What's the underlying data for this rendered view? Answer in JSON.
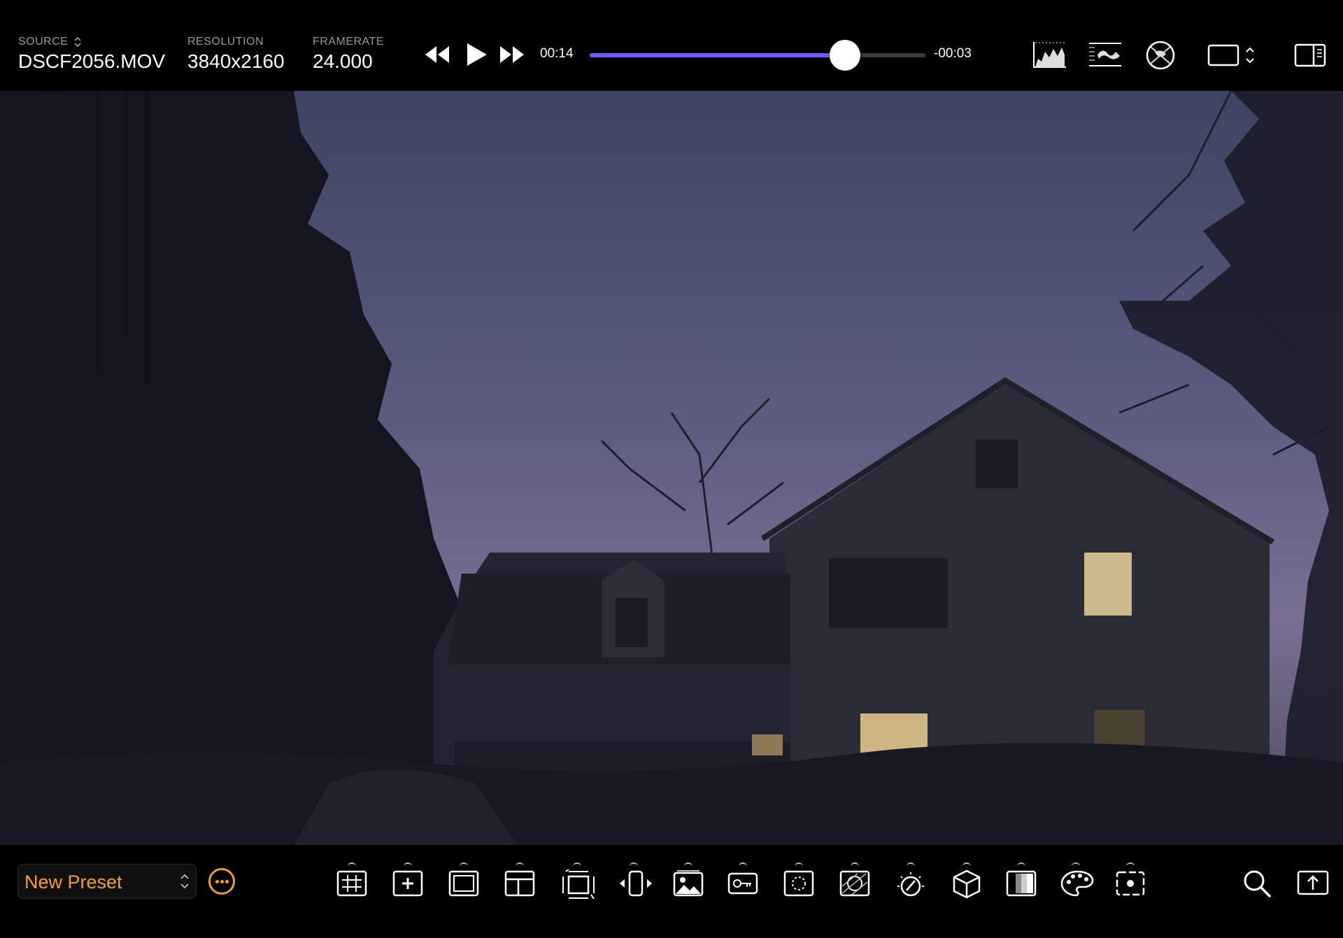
{
  "header": {
    "source": {
      "label": "SOURCE",
      "value": "DSCF2056.MOV"
    },
    "resolution": {
      "label": "RESOLUTION",
      "value": "3840x2160"
    },
    "framerate": {
      "label": "FRAMERATE",
      "value": "24.000"
    }
  },
  "transport": {
    "elapsed": "00:14",
    "remaining": "-00:03",
    "progress_fraction": 0.76
  },
  "header_tools": [
    "histogram-icon",
    "waveform-icon",
    "vectorscope-icon",
    "frame-aspect-selector-icon",
    "sidebar-toggle-icon"
  ],
  "footer": {
    "preset_label": "New Preset",
    "tools": [
      "grid-guide-icon",
      "center-marker-icon",
      "frame-guide-icon",
      "safe-area-icon",
      "transform-icon",
      "flip-icon",
      "image-overlay-icon",
      "key-icon",
      "focus-peaking-icon",
      "false-color-icon",
      "exposure-meter-icon",
      "lut-cube-icon",
      "zebra-icon",
      "color-palette-icon",
      "spot-meter-icon"
    ],
    "right_tools": [
      "search-icon",
      "export-icon"
    ]
  },
  "colors": {
    "accent": "#6b5cff",
    "preset_text": "#f0a030",
    "background": "#000000"
  }
}
